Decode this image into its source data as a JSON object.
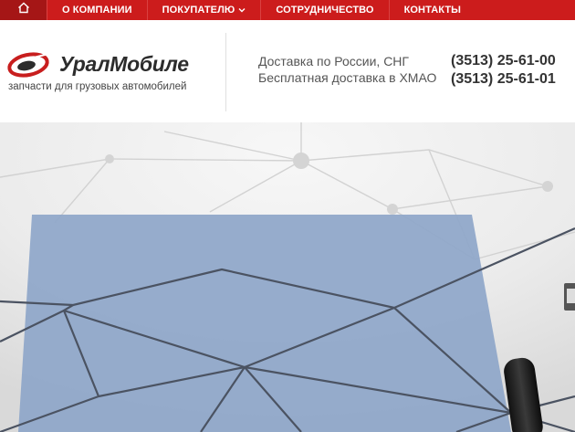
{
  "nav": {
    "home_icon": "home-icon",
    "items": [
      {
        "label": "О КОМПАНИИ"
      },
      {
        "label": "ПОКУПАТЕЛЮ",
        "has_dropdown": true
      },
      {
        "label": "СОТРУДНИЧЕСТВО"
      },
      {
        "label": "КОНТАКТЫ"
      }
    ],
    "colors": {
      "bar": "#cc1c1c",
      "home_bg": "#a51616",
      "text": "#ffffff"
    }
  },
  "header": {
    "brand": "УралМобиле",
    "tagline": "запчасти для грузовых автомобилей",
    "delivery": [
      "Доставка по России, СНГ",
      "Бесплатная доставка в ХМАО"
    ],
    "phones": [
      "(3513) 25-61-00",
      "(3513) 25-61-01"
    ]
  },
  "hero": {
    "colors": {
      "background": "#eeeeee",
      "panel": "#8ea6c9",
      "lines": "#4b5362"
    }
  }
}
